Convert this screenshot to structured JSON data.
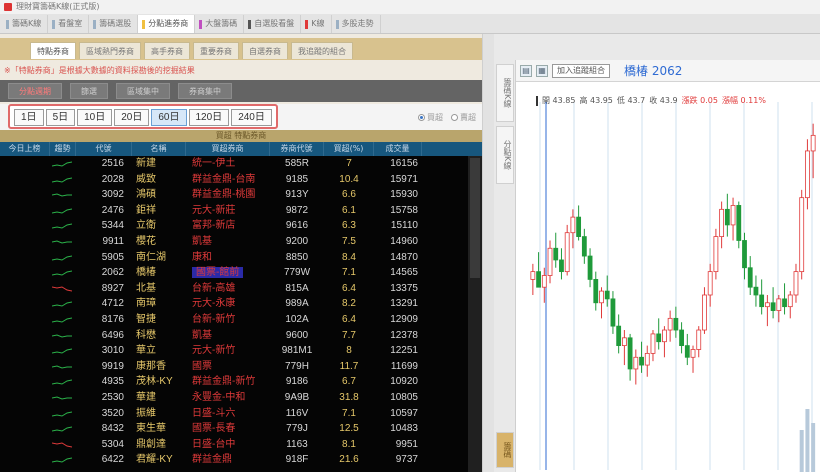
{
  "window": {
    "title": "理財寶籌碼K線(正式版)"
  },
  "main_tabs": [
    {
      "label": "籌碼K線",
      "mark": ""
    },
    {
      "label": "看盤室",
      "mark": ""
    },
    {
      "label": "籌碼選股",
      "mark": ""
    },
    {
      "label": "分點進券商",
      "mark": "#f0c040",
      "active": true
    },
    {
      "label": "大盤籌碼",
      "mark": "#c04fc0"
    },
    {
      "label": "自選股看盤",
      "mark": "#555555"
    },
    {
      "label": "K線",
      "mark": "#e03a3a"
    },
    {
      "label": "多股走勢",
      "mark": ""
    }
  ],
  "sub_tabs": [
    {
      "label": "特點券商",
      "active": true
    },
    {
      "label": "區域熱門券商"
    },
    {
      "label": "高手券商"
    },
    {
      "label": "重要券商"
    },
    {
      "label": "自選券商"
    },
    {
      "label": "我追蹤的組合"
    }
  ],
  "notice": "※「特點券商」是根據大數據的資料探勘後的挖掘結果",
  "toolbar": [
    {
      "label": "分點週期",
      "hot": true
    },
    {
      "label": "篩選"
    },
    {
      "label": "區域集中"
    },
    {
      "label": "券商集中"
    }
  ],
  "periods": [
    {
      "label": "1日"
    },
    {
      "label": "5日"
    },
    {
      "label": "10日"
    },
    {
      "label": "20日"
    },
    {
      "label": "60日",
      "active": true
    },
    {
      "label": "120日"
    },
    {
      "label": "240日"
    }
  ],
  "radios": [
    {
      "label": "買超",
      "on": true
    },
    {
      "label": "賣超",
      "on": false
    }
  ],
  "grid": {
    "caption": "買超 特點券商",
    "columns": [
      "今日上榜",
      "趨勢",
      "代號",
      "名稱",
      "買超券商",
      "券商代號",
      "買超(%)",
      "成交量"
    ],
    "rows": [
      {
        "code": "2516",
        "name": "新建",
        "broker": "統一-伊土",
        "broker_code": "585R",
        "pct": "7",
        "volume": "16156",
        "trend": "up"
      },
      {
        "code": "2028",
        "name": "威致",
        "broker": "群益金鼎-台南",
        "broker_code": "9185",
        "pct": "10.4",
        "volume": "15971",
        "trend": "up"
      },
      {
        "code": "3092",
        "name": "鴻碩",
        "broker": "群益金鼎-桃園",
        "broker_code": "913Y",
        "pct": "6.6",
        "volume": "15930",
        "trend": "flat"
      },
      {
        "code": "2476",
        "name": "鉅祥",
        "broker": "元大-新莊",
        "broker_code": "9872",
        "pct": "6.1",
        "volume": "15758",
        "trend": "up"
      },
      {
        "code": "5344",
        "name": "立衛",
        "broker": "富邦-新店",
        "broker_code": "9616",
        "pct": "6.3",
        "volume": "15110",
        "trend": "up"
      },
      {
        "code": "9911",
        "name": "櫻花",
        "broker": "凱基",
        "broker_code": "9200",
        "pct": "7.5",
        "volume": "14960",
        "trend": "flat"
      },
      {
        "code": "5905",
        "name": "南仁湖",
        "broker": "康和",
        "broker_code": "8850",
        "pct": "8.4",
        "volume": "14870",
        "trend": "up"
      },
      {
        "code": "2062",
        "name": "橋椿",
        "broker": "國票-館前",
        "broker_code": "779W",
        "pct": "7.1",
        "volume": "14565",
        "trend": "up",
        "selected": true
      },
      {
        "code": "8927",
        "name": "北基",
        "broker": "台新-高雄",
        "broker_code": "815A",
        "pct": "6.4",
        "volume": "13375",
        "trend": "down"
      },
      {
        "code": "4712",
        "name": "南璋",
        "broker": "元大-永康",
        "broker_code": "989A",
        "pct": "8.2",
        "volume": "13291",
        "trend": "up"
      },
      {
        "code": "8176",
        "name": "智捷",
        "broker": "台新-新竹",
        "broker_code": "102A",
        "pct": "6.4",
        "volume": "12909",
        "trend": "up"
      },
      {
        "code": "6496",
        "name": "科懋",
        "broker": "凱基",
        "broker_code": "9600",
        "pct": "7.7",
        "volume": "12378",
        "trend": "flat"
      },
      {
        "code": "3010",
        "name": "華立",
        "broker": "元大-新竹",
        "broker_code": "981M1",
        "pct": "8",
        "volume": "12251",
        "trend": "up"
      },
      {
        "code": "9919",
        "name": "康那香",
        "broker": "國票",
        "broker_code": "779H",
        "pct": "11.7",
        "volume": "11699",
        "trend": "flat"
      },
      {
        "code": "4935",
        "name": "茂林-KY",
        "broker": "群益金鼎-新竹",
        "broker_code": "9186",
        "pct": "6.7",
        "volume": "10920",
        "trend": "up"
      },
      {
        "code": "2530",
        "name": "華建",
        "broker": "永豐金-中和",
        "broker_code": "9A9B",
        "pct": "31.8",
        "volume": "10805",
        "trend": "flat"
      },
      {
        "code": "3520",
        "name": "振維",
        "broker": "日盛-斗六",
        "broker_code": "116V",
        "pct": "7.1",
        "volume": "10597",
        "trend": "up"
      },
      {
        "code": "8432",
        "name": "東生華",
        "broker": "國票-長春",
        "broker_code": "779J",
        "pct": "12.5",
        "volume": "10483",
        "trend": "up"
      },
      {
        "code": "5304",
        "name": "鼎創達",
        "broker": "日盛-台中",
        "broker_code": "1163",
        "pct": "8.1",
        "volume": "9951",
        "trend": "down"
      },
      {
        "code": "6422",
        "name": "君耀-KY",
        "broker": "群益金鼎",
        "broker_code": "918F",
        "pct": "21.6",
        "volume": "9737",
        "trend": "up"
      }
    ]
  },
  "side_tabs": [
    "籌碼K線",
    "分點K線"
  ],
  "side_tab_bottom": "籌碼",
  "chart_header": {
    "add_button": "加入追蹤組合",
    "stock_title": "橋椿 2062",
    "icons": [
      "folder-icon",
      "grid-icon"
    ]
  },
  "ohlc": {
    "open": "開 43.85",
    "high": "高 43.95",
    "low": "低 43.7",
    "close": "收 43.9",
    "change": "漲跌 0.05",
    "change_pct": "漲幅 0.11%"
  },
  "chart_data": {
    "type": "candlestick",
    "title": "",
    "candles": [
      [
        40.2,
        40.6,
        39.8,
        40.4
      ],
      [
        40.4,
        40.9,
        40.1,
        40.0
      ],
      [
        40.0,
        40.5,
        39.6,
        40.3
      ],
      [
        40.3,
        41.2,
        40.1,
        41.0
      ],
      [
        41.0,
        41.4,
        40.5,
        40.7
      ],
      [
        40.7,
        41.0,
        40.2,
        40.4
      ],
      [
        40.4,
        41.6,
        40.3,
        41.4
      ],
      [
        41.4,
        42.0,
        41.0,
        41.8
      ],
      [
        41.8,
        42.1,
        41.2,
        41.3
      ],
      [
        41.3,
        41.5,
        40.6,
        40.8
      ],
      [
        40.8,
        41.0,
        40.0,
        40.2
      ],
      [
        40.2,
        40.4,
        39.4,
        39.6
      ],
      [
        39.6,
        40.0,
        39.2,
        39.9
      ],
      [
        39.9,
        40.3,
        39.5,
        39.7
      ],
      [
        39.7,
        39.9,
        38.8,
        39.0
      ],
      [
        39.0,
        39.3,
        38.3,
        38.5
      ],
      [
        38.5,
        38.9,
        38.0,
        38.7
      ],
      [
        38.7,
        38.8,
        37.6,
        37.9
      ],
      [
        37.9,
        38.4,
        37.5,
        38.2
      ],
      [
        38.2,
        38.6,
        37.8,
        38.0
      ],
      [
        38.0,
        38.5,
        37.7,
        38.3
      ],
      [
        38.3,
        38.9,
        38.1,
        38.8
      ],
      [
        38.8,
        39.2,
        38.4,
        38.6
      ],
      [
        38.6,
        39.0,
        38.2,
        38.9
      ],
      [
        38.9,
        39.4,
        38.6,
        39.2
      ],
      [
        39.2,
        39.5,
        38.7,
        38.9
      ],
      [
        38.9,
        39.1,
        38.3,
        38.5
      ],
      [
        38.5,
        38.8,
        38.0,
        38.2
      ],
      [
        38.2,
        38.5,
        37.8,
        38.4
      ],
      [
        38.4,
        39.0,
        38.2,
        38.9
      ],
      [
        38.9,
        40.0,
        38.8,
        39.8
      ],
      [
        39.8,
        40.6,
        39.5,
        40.4
      ],
      [
        40.4,
        41.5,
        40.2,
        41.3
      ],
      [
        41.3,
        42.2,
        41.0,
        42.0
      ],
      [
        42.0,
        42.4,
        41.3,
        41.6
      ],
      [
        41.6,
        42.3,
        41.2,
        42.1
      ],
      [
        42.1,
        42.2,
        41.0,
        41.2
      ],
      [
        41.2,
        41.4,
        40.2,
        40.5
      ],
      [
        40.5,
        40.8,
        39.8,
        40.0
      ],
      [
        40.0,
        40.3,
        39.5,
        39.8
      ],
      [
        39.8,
        40.2,
        39.3,
        39.5
      ],
      [
        39.5,
        39.8,
        39.0,
        39.6
      ],
      [
        39.6,
        40.0,
        39.2,
        39.4
      ],
      [
        39.4,
        39.8,
        39.1,
        39.7
      ],
      [
        39.7,
        40.1,
        39.3,
        39.5
      ],
      [
        39.5,
        39.9,
        39.2,
        39.8
      ],
      [
        39.8,
        40.6,
        39.6,
        40.4
      ],
      [
        40.4,
        42.5,
        40.2,
        42.3
      ],
      [
        42.3,
        43.8,
        42.0,
        43.5
      ],
      [
        43.5,
        44.2,
        42.8,
        43.9
      ]
    ],
    "volumes": [
      0,
      0,
      0,
      0,
      0,
      0,
      0,
      0,
      0,
      0,
      0,
      0,
      0,
      0,
      0,
      0,
      0,
      0,
      0,
      0,
      0,
      0,
      0,
      0,
      0,
      0,
      0,
      0,
      0,
      0,
      0,
      0,
      0,
      0,
      0,
      0,
      0,
      0,
      0,
      0,
      0,
      0,
      0,
      0,
      0,
      0,
      0,
      0.6,
      0.9,
      0.7
    ],
    "ylim": [
      37,
      44.5
    ],
    "marker_series_index": 0,
    "colors": {
      "up": "#e03a3a",
      "down": "#1f9a3a",
      "grid": "#cfe0ef",
      "volume": "#b7c9da",
      "marker": "#2f6bd3"
    }
  },
  "colors": {
    "header_bg": "#17577e",
    "accent_red": "#e03a3a",
    "stock_title": "#2f6bd3"
  }
}
